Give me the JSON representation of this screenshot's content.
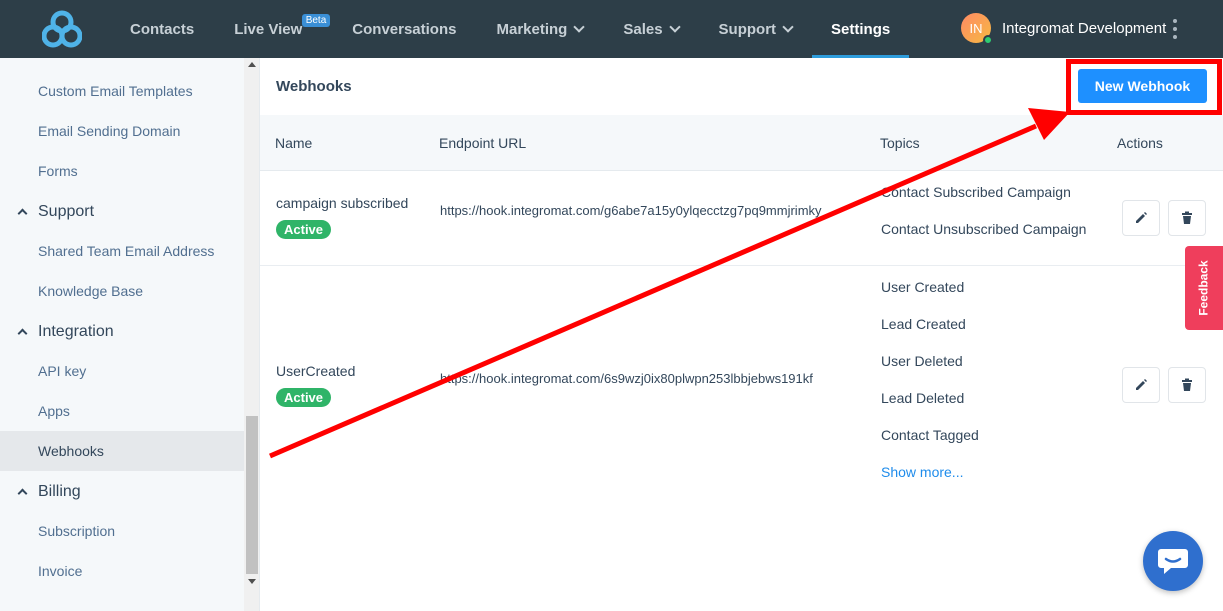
{
  "nav": {
    "items": [
      {
        "label": "Contacts"
      },
      {
        "label": "Live View",
        "badge": "Beta"
      },
      {
        "label": "Conversations"
      },
      {
        "label": "Marketing"
      },
      {
        "label": "Sales"
      },
      {
        "label": "Support"
      },
      {
        "label": "Settings"
      }
    ],
    "account": {
      "initials": "IN",
      "name": "Integromat Development"
    }
  },
  "sidebar": {
    "items": [
      {
        "label": "Custom Email Templates"
      },
      {
        "label": "Email Sending Domain"
      },
      {
        "label": "Forms"
      }
    ],
    "support": {
      "label": "Support",
      "items": [
        {
          "label": "Shared Team Email Address"
        },
        {
          "label": "Knowledge Base"
        }
      ]
    },
    "integration": {
      "label": "Integration",
      "items": [
        {
          "label": "API key"
        },
        {
          "label": "Apps"
        },
        {
          "label": "Webhooks"
        }
      ]
    },
    "billing": {
      "label": "Billing",
      "items": [
        {
          "label": "Subscription"
        },
        {
          "label": "Invoice"
        }
      ]
    }
  },
  "main": {
    "title": "Webhooks",
    "new_button": "New Webhook",
    "columns": {
      "name": "Name",
      "endpoint": "Endpoint URL",
      "topics": "Topics",
      "actions": "Actions"
    },
    "rows": [
      {
        "name": "campaign subscribed",
        "status": "Active",
        "url": "https://hook.integromat.com/g6abe7a15y0ylqecctzg7pq9mmjrimky",
        "topics": [
          "Contact Subscribed Campaign",
          "Contact Unsubscribed Campaign"
        ]
      },
      {
        "name": "UserCreated",
        "status": "Active",
        "url": "https://hook.integromat.com/6s9wzj0ix80plwpn253lbbjebws191kf",
        "topics": [
          "User Created",
          "Lead Created",
          "User Deleted",
          "Lead Deleted",
          "Contact Tagged"
        ],
        "show_more": "Show more..."
      }
    ]
  },
  "feedback_label": "Feedback",
  "colors": {
    "nav_bg": "#2d3e48",
    "primary": "#1e90ff",
    "active_badge": "#2fb468",
    "annotation": "#ff0000",
    "feedback": "#ef3e5c"
  }
}
